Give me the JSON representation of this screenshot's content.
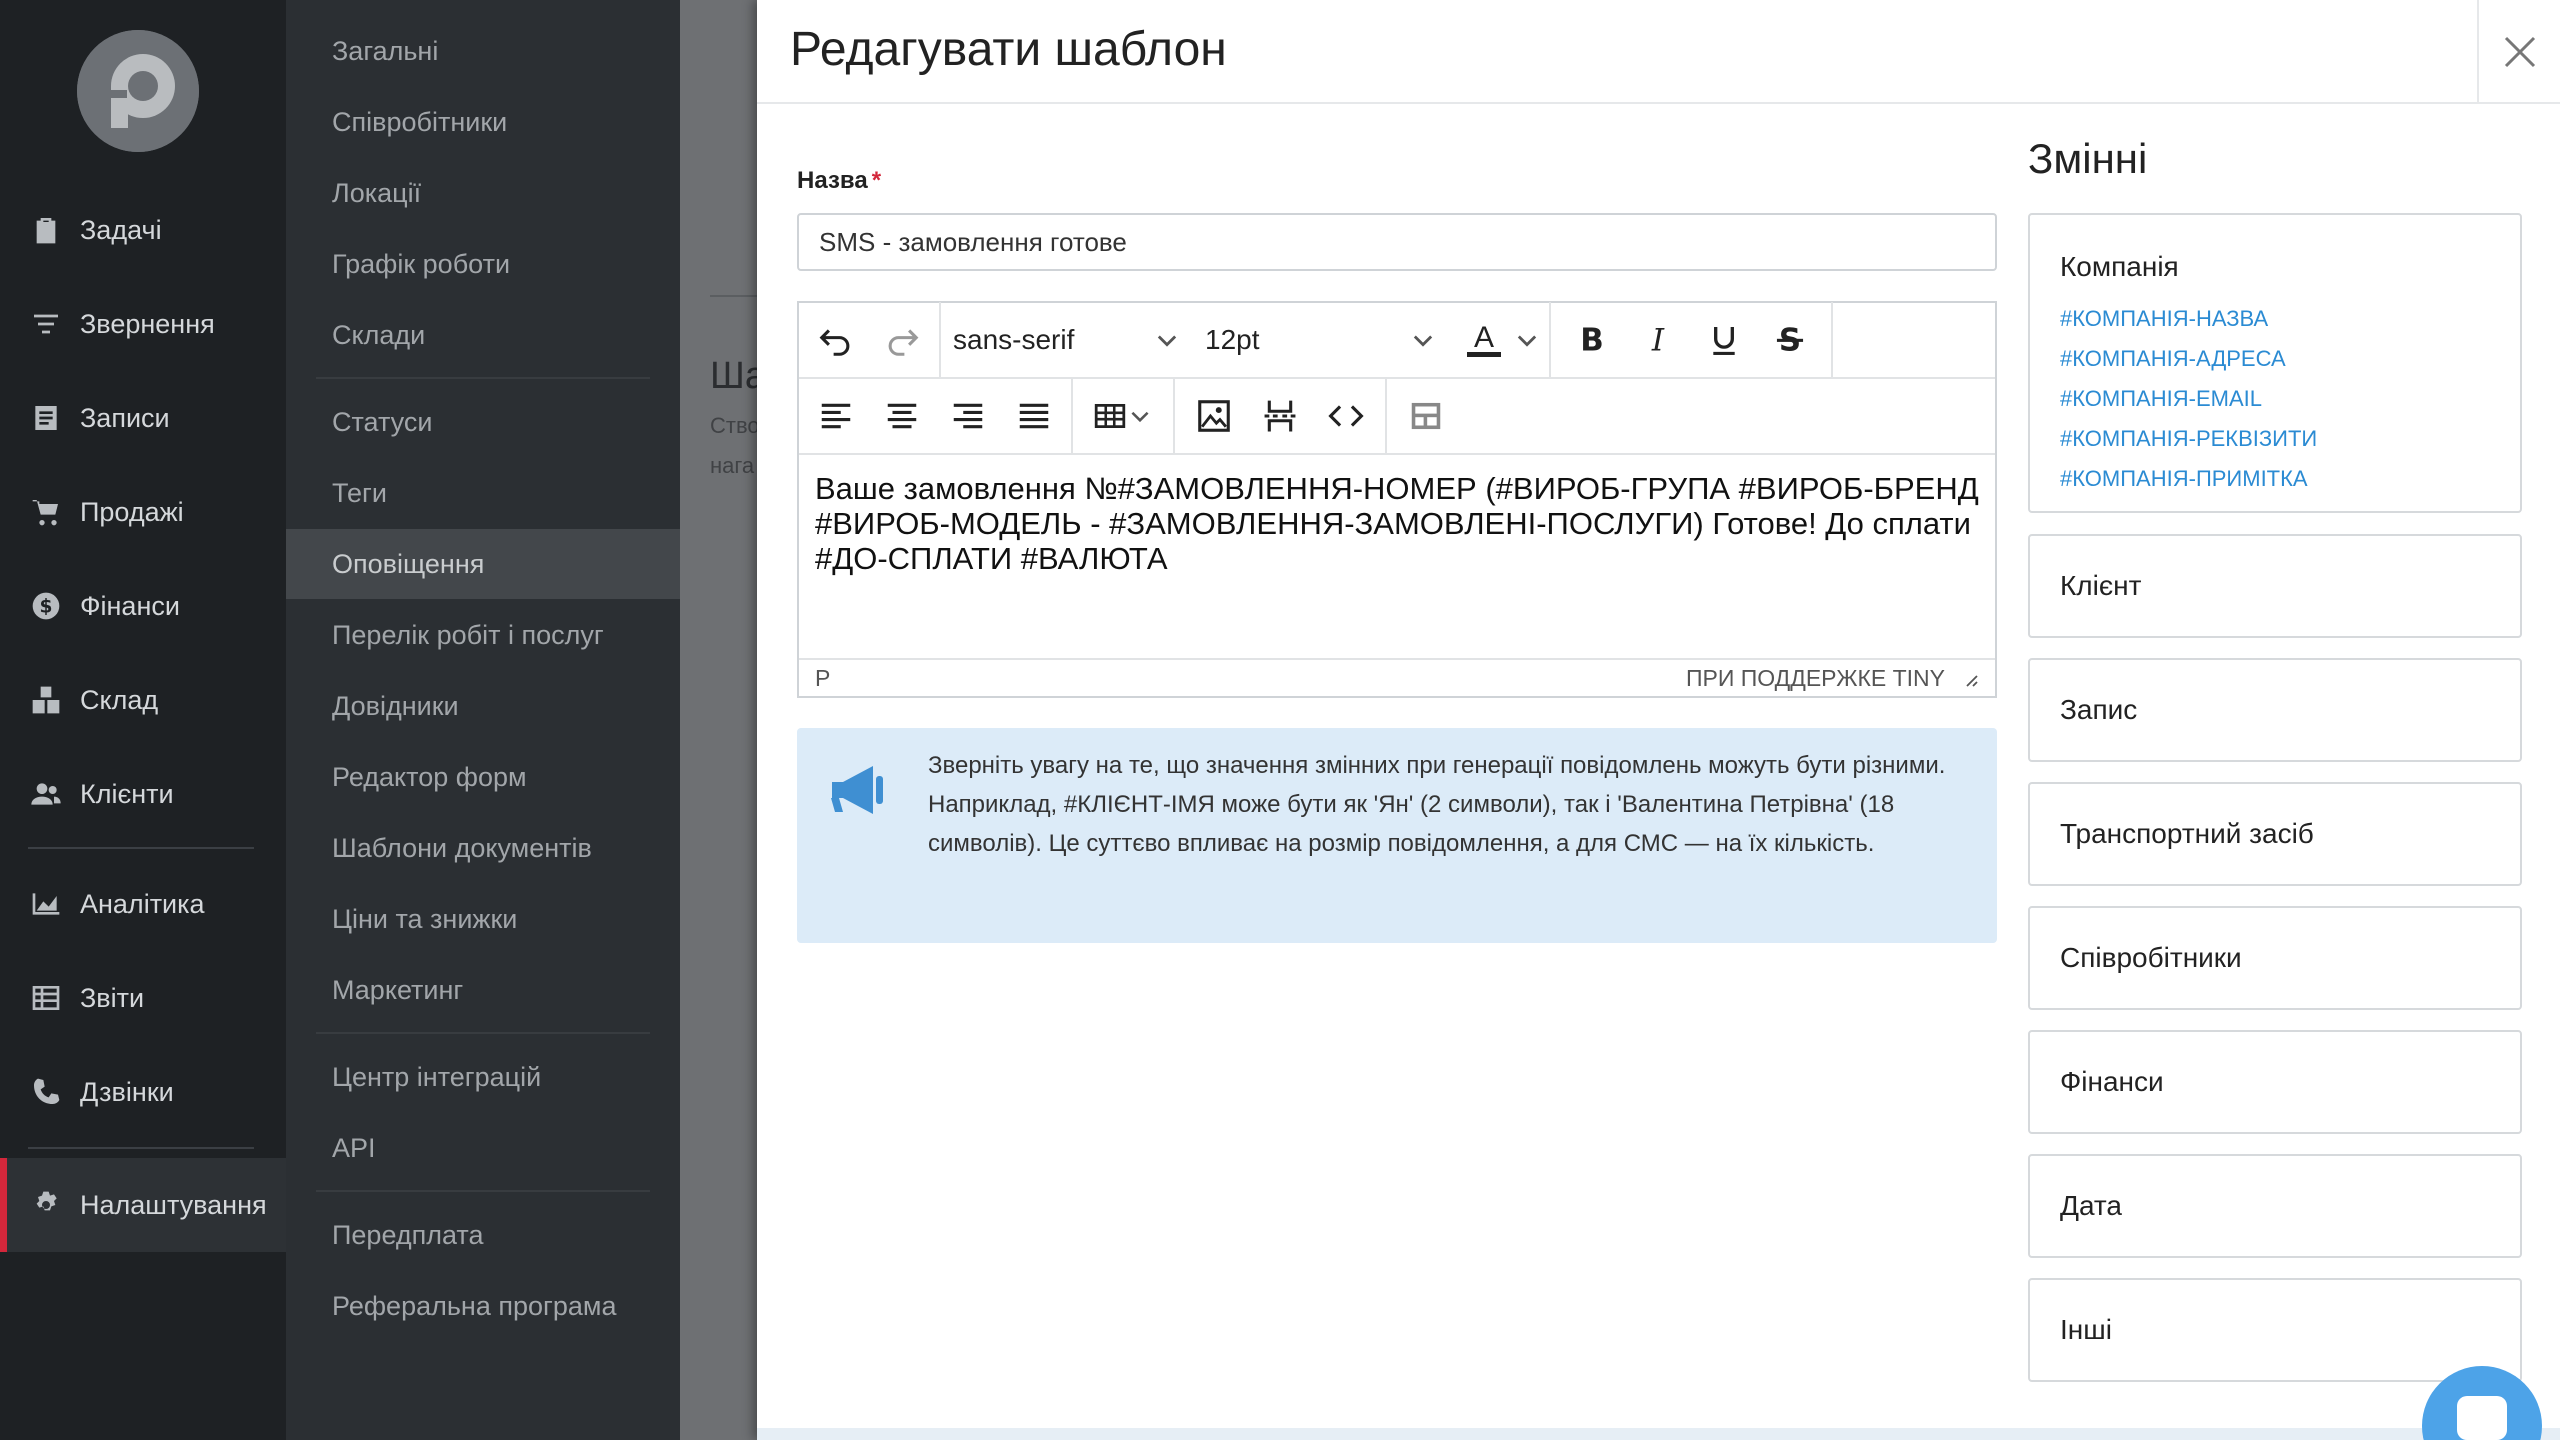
{
  "rail": {
    "items": [
      {
        "label": "Задачі",
        "icon": "clipboard-check-icon"
      },
      {
        "label": "Звернення",
        "icon": "filter-icon"
      },
      {
        "label": "Записи",
        "icon": "notes-icon"
      },
      {
        "label": "Продажі",
        "icon": "cart-icon"
      },
      {
        "label": "Фінанси",
        "icon": "dollar-circle-icon"
      },
      {
        "label": "Склад",
        "icon": "boxes-icon"
      },
      {
        "label": "Клієнти",
        "icon": "users-icon"
      },
      {
        "label": "Аналітика",
        "icon": "area-chart-icon"
      },
      {
        "label": "Звіти",
        "icon": "table-icon"
      },
      {
        "label": "Дзвінки",
        "icon": "phone-icon"
      },
      {
        "label": "Налаштування",
        "icon": "gear-icon"
      }
    ],
    "active": "Налаштування"
  },
  "subnav": {
    "items": [
      "Загальні",
      "Співробітники",
      "Локації",
      "Графік роботи",
      "Склади",
      "Статуси",
      "Теги",
      "Оповіщення",
      "Перелік робіт і послуг",
      "Довідники",
      "Редактор форм",
      "Шаблони документів",
      "Ціни та знижки",
      "Маркетинг",
      "Центр інтеграцій",
      "API",
      "Передплата",
      "Реферальна програма"
    ],
    "active": "Оповіщення"
  },
  "behind": {
    "heading": "Ша",
    "text_line1": "Ство",
    "text_line2": "нага"
  },
  "modal": {
    "title": "Редагувати шаблон",
    "name_label": "Назва",
    "required_mark": "*",
    "name_value": "SMS - замовлення готове",
    "editor": {
      "font_family": "sans-serif",
      "font_size": "12pt",
      "text_color_label": "A",
      "text_color": "#d3273b",
      "content": "Ваше замовлення №#ЗАМОВЛЕННЯ-НОМЕР (#ВИРОБ-ГРУПА #ВИРОБ-БРЕНД #ВИРОБ-МОДЕЛЬ - #ЗАМОВЛЕННЯ-ЗАМОВЛЕНІ-ПОСЛУГИ) Готове! До сплати #ДО-СПЛАТИ #ВАЛЮТА",
      "status_path": "P",
      "powered_by": "ПРИ ПОДДЕРЖКЕ TINY"
    },
    "notice": "Зверніть увагу на те, що значення змінних при генерації повідомлень можуть бути різними. Наприклад, #КЛІЄНТ-ІМЯ може бути як 'Ян' (2 символи), так і 'Валентина Петрівна' (18 символів). Це суттєво впливає на розмір повідомлення, а для СМС — на їх кількість.",
    "variables": {
      "title": "Змінні",
      "company": {
        "title": "Компанія",
        "links": [
          "#КОМПАНІЯ-НАЗВА",
          "#КОМПАНІЯ-АДРЕСА",
          "#КОМПАНІЯ-EMAIL",
          "#КОМПАНІЯ-РЕКВІЗИТИ",
          "#КОМПАНІЯ-ПРИМІТКА"
        ]
      },
      "groups": [
        "Клієнт",
        "Запис",
        "Транспортний засіб",
        "Співробітники",
        "Фінанси",
        "Дата",
        "Інші"
      ]
    }
  },
  "colors": {
    "accent": "#d3273b",
    "link": "#2b8bd3",
    "notice_bg": "#dcebf8"
  }
}
